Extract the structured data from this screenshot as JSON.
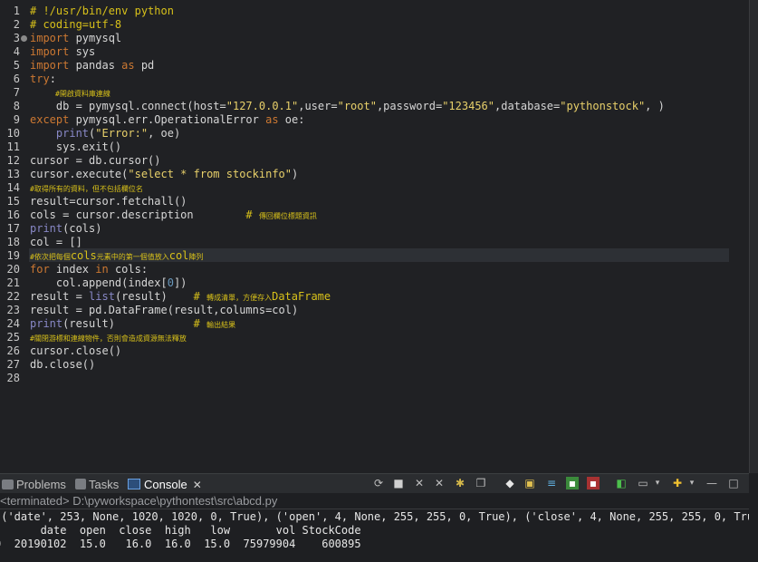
{
  "editor": {
    "line_numbers": [
      "1",
      "2",
      "3",
      "4",
      "5",
      "6",
      "7",
      "8",
      "9",
      "10",
      "11",
      "12",
      "13",
      "14",
      "15",
      "16",
      "17",
      "18",
      "19",
      "20",
      "21",
      "22",
      "23",
      "24",
      "25",
      "26",
      "27",
      "28"
    ],
    "lines": {
      "l1": "# !/usr/bin/env python",
      "l2": "# coding=utf-8",
      "l3a": "import",
      "l3b": " pymysql",
      "l4a": "import",
      "l4b": " sys",
      "l5a": "import",
      "l5b": " pandas ",
      "l5c": "as",
      "l5d": " pd",
      "l6a": "try",
      "l6b": ":",
      "l7": "#開啟資料庫連線",
      "l8a": "    db = pymysql.connect(host=",
      "l8b": "\"127.0.0.1\"",
      "l8c": ",user=",
      "l8d": "\"root\"",
      "l8e": ",password=",
      "l8f": "\"123456\"",
      "l8g": ",database=",
      "l8h": "\"pythonstock\"",
      "l8i": ", )",
      "l9a": "except",
      "l9b": " pymysql.err.OperationalError ",
      "l9c": "as",
      "l9d": " oe:",
      "l10a": "    ",
      "l10b": "print",
      "l10c": "(",
      "l10d": "\"Error:\"",
      "l10e": ", oe)",
      "l11": "    sys.exit()",
      "l12": "cursor = db.cursor()",
      "l13a": "cursor.execute(",
      "l13b": "\"select * from stockinfo\"",
      "l13c": ")",
      "l14": "#取得所有的資料，但不包括欄位名",
      "l15": "result=cursor.fetchall()",
      "l16a": "cols = cursor.description        ",
      "l16b": "# ",
      "l16c": "傳回欄位標題資訊",
      "l17a": "print",
      "l17b": "(cols)",
      "l18": "col = []",
      "l19a": "#依次把每個",
      "l19b": "cols",
      "l19c": "元素中的第一個值放入",
      "l19d": "col",
      "l19e": "陣列",
      "l20a": "for",
      "l20b": " index ",
      "l20c": "in",
      "l20d": " cols:",
      "l21a": "    col.append(index[",
      "l21b": "0",
      "l21c": "])",
      "l22a": "result = ",
      "l22b": "list",
      "l22c": "(result)    ",
      "l22d": "# ",
      "l22e": "轉成清單，方便存入",
      "l22f": "DataFrame",
      "l23": "result = pd.DataFrame(result,columns=col)",
      "l24a": "print",
      "l24b": "(result)            ",
      "l24c": "# ",
      "l24d": "輸出結果",
      "l25": "#關閉游標和連線物件，否則會造成資源無法釋放",
      "l26": "cursor.close()",
      "l27": "db.close()"
    }
  },
  "console": {
    "tabs": {
      "problems": "Problems",
      "tasks": "Tasks",
      "console": "Console"
    },
    "terminated": "<terminated> D:\\pyworkspace\\pythontest\\src\\abcd.py",
    "output": {
      "o1": "(('date', 253, None, 1020, 1020, 0, True), ('open', 4, None, 255, 255, 0, True), ('close', 4, None, 255, 255, 0, True",
      "o2": "       date  open  close  high   low       vol StockCode",
      "o3": "0  20190102  15.0   16.0  16.0  15.0  75979904    600895"
    }
  },
  "colors": {
    "editor_bg": "#202124",
    "comment": "#d7c01a",
    "keyword": "#cc7832",
    "builtin": "#8888c6",
    "string": "#e8d06a",
    "number": "#6897bb"
  }
}
